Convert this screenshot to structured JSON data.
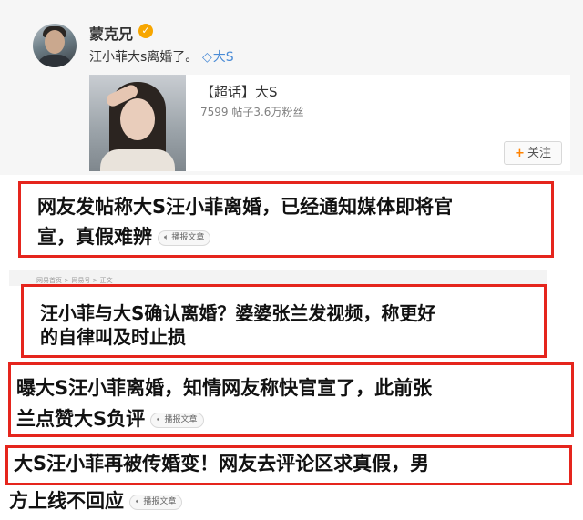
{
  "post": {
    "username": "蒙克兄",
    "text": "汪小菲大s离婚了。",
    "topic_icon": "◇",
    "topic": "大S",
    "card": {
      "title": "【超话】大S",
      "stats": "7599 帖子3.6万粉丝",
      "follow_icon": "+",
      "follow_label": "关注"
    }
  },
  "headlines": [
    {
      "line1": "网友发帖称大S汪小菲离婚，已经通知媒体即将官",
      "line2": "宣，真假难辨",
      "badge": "播报文章"
    },
    {
      "crumb": "网易首页 > 网易号 > 正文",
      "line1": "汪小菲与大S确认离婚？婆婆张兰发视频，称更好",
      "line2": "的自律叫及时止损"
    },
    {
      "line1": "曝大S汪小菲离婚，知情网友称快官宣了，此前张",
      "line2": "兰点赞大S负评",
      "badge": "播报文章"
    },
    {
      "line1": "大S汪小菲再被传婚变！网友去评论区求真假，男",
      "line2": "方上线不回应",
      "badge": "播报文章"
    }
  ],
  "colors": {
    "highlight_border": "#e5251d",
    "weibo_orange": "#ff8200",
    "verified": "#f7a600",
    "topic_blue": "#4a8bd6"
  }
}
